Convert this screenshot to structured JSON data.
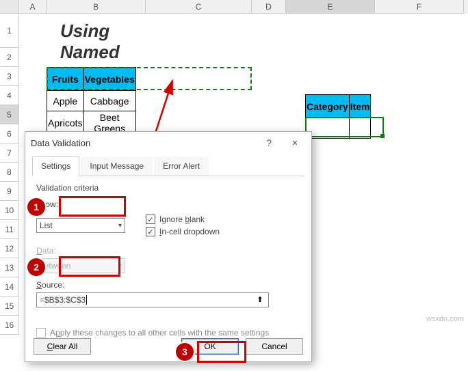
{
  "columns": {
    "A": "A",
    "B": "B",
    "C": "C",
    "D": "D",
    "E": "E",
    "F": "F"
  },
  "rows": [
    "1",
    "2",
    "3",
    "4",
    "5",
    "6",
    "7",
    "8",
    "9",
    "10",
    "11",
    "12",
    "13",
    "14",
    "15",
    "16"
  ],
  "title": "Using Named Range",
  "table1": {
    "headers": [
      "Fruits",
      "Vegetables"
    ],
    "rows": [
      [
        "Apple",
        "Cabbage"
      ],
      [
        "Apricots",
        "Beet Greens"
      ]
    ]
  },
  "table2": {
    "headers": [
      "Category",
      "Item"
    ]
  },
  "dialog": {
    "title": "Data Validation",
    "help": "?",
    "close": "×",
    "tabs": {
      "settings": "Settings",
      "input": "Input Message",
      "error": "Error Alert"
    },
    "criteria_label": "Validation criteria",
    "allow_label": "Allow:",
    "allow_value": "List",
    "ignore_blank": "Ignore blank",
    "incell": "In-cell dropdown",
    "data_label": "Data:",
    "data_value": "between",
    "source_label": "Source:",
    "source_value": "=$B$3:$C$3",
    "apply": "Apply these changes to all other cells with the same settings",
    "clear": "Clear All",
    "ok": "OK",
    "cancel": "Cancel"
  },
  "badges": {
    "b1": "1",
    "b2": "2",
    "b3": "3"
  },
  "watermark": "wsxdn.com"
}
